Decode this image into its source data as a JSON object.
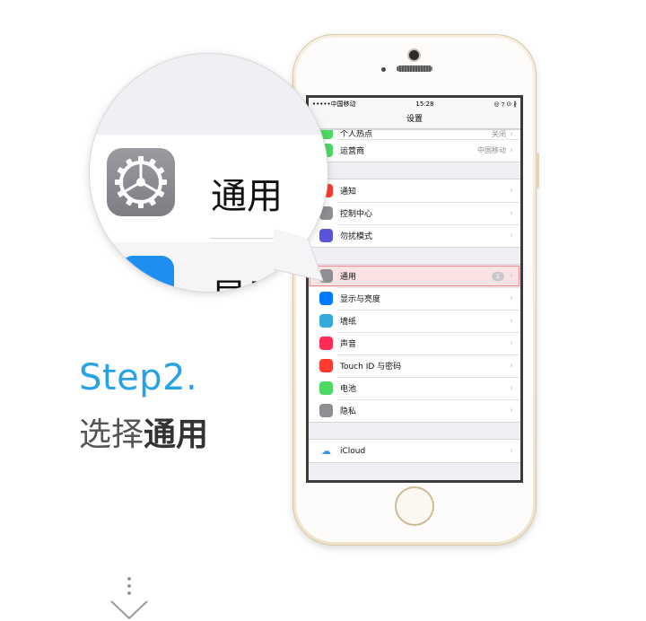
{
  "step": {
    "title": "Step2.",
    "instruction_prefix": "选择",
    "instruction_bold": "通用"
  },
  "colors": {
    "step_title": "#27a2e6",
    "highlight_border": "#ef8d95",
    "highlight_fill": "#fbe3e4"
  },
  "magnifier": {
    "label": "通用",
    "next_label_partial": "显示"
  },
  "statusbar": {
    "carrier": "•••••中国移动",
    "time": "15:28",
    "icons": "◎ ⁊ ⊙ ∦"
  },
  "navbar": {
    "title": "设置"
  },
  "groups": [
    {
      "rows": [
        {
          "name": "row-personal-hotspot-partial",
          "label": "个人热点",
          "value": "关闭",
          "icon": "hotspot-icon",
          "color": "#4cd964",
          "partial": true
        },
        {
          "name": "row-carrier",
          "label": "运营商",
          "value": "中国移动",
          "icon": "phone-icon",
          "color": "#4cd964"
        }
      ]
    },
    {
      "rows": [
        {
          "name": "row-notifications",
          "label": "通知",
          "value": "",
          "icon": "notification-icon",
          "color": "#ff3b30"
        },
        {
          "name": "row-control-center",
          "label": "控制中心",
          "value": "",
          "icon": "control-center-icon",
          "color": "#8e8e93"
        },
        {
          "name": "row-do-not-disturb",
          "label": "勿扰模式",
          "value": "",
          "icon": "moon-icon",
          "color": "#5856d6"
        }
      ]
    },
    {
      "rows": [
        {
          "name": "row-general",
          "label": "通用",
          "value": "",
          "badge": "1",
          "icon": "gear-icon",
          "color": "#8e8e93",
          "highlight": true
        },
        {
          "name": "row-display",
          "label": "显示与亮度",
          "value": "",
          "icon": "display-icon",
          "color": "#007aff"
        },
        {
          "name": "row-wallpaper",
          "label": "墙纸",
          "value": "",
          "icon": "wallpaper-icon",
          "color": "#34aadc"
        },
        {
          "name": "row-sounds",
          "label": "声音",
          "value": "",
          "icon": "sound-icon",
          "color": "#ff2d55"
        },
        {
          "name": "row-touch-id",
          "label": "Touch ID 与密码",
          "value": "",
          "icon": "fingerprint-icon",
          "color": "#ff3b30"
        },
        {
          "name": "row-battery",
          "label": "电池",
          "value": "",
          "icon": "battery-icon",
          "color": "#4cd964"
        },
        {
          "name": "row-privacy",
          "label": "隐私",
          "value": "",
          "icon": "hand-icon",
          "color": "#8e8e93"
        }
      ]
    },
    {
      "rows": [
        {
          "name": "row-icloud",
          "label": "iCloud",
          "value": "",
          "icon": "cloud-icon",
          "color": "#ffffff"
        }
      ]
    }
  ]
}
